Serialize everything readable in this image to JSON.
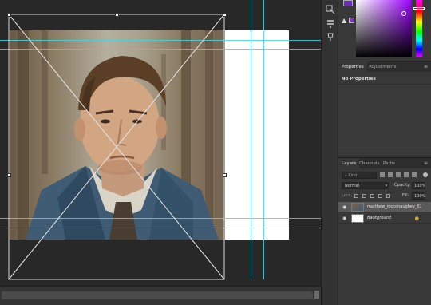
{
  "properties_panel": {
    "tabs": [
      "Properties",
      "Adjustments"
    ],
    "active_tab": "Properties",
    "body_text": "No Properties"
  },
  "layers_panel": {
    "tabs": [
      "Layers",
      "Channels",
      "Paths"
    ],
    "active_tab": "Layers",
    "filter_placeholder": "Kind",
    "blend_mode": "Normal",
    "opacity_label": "Opacity:",
    "opacity_value": "100%",
    "lock_label": "Lock:",
    "fill_label": "Fill:",
    "fill_value": "100%",
    "layers": [
      {
        "name": "matthew_mcconaughey_01",
        "selected": true
      },
      {
        "name": "Background",
        "selected": false,
        "locked": true
      }
    ]
  },
  "colors": {
    "foreground": "#6b2bb8",
    "guide": "#3fd6e6",
    "panel_bg": "#383838",
    "canvas_bg": "#282828"
  },
  "icons": {
    "swatch_warning": "warning-triangle-icon",
    "panel_menu": "hamburger-menu-icon",
    "eye": "eye-icon",
    "lock": "lock-icon"
  }
}
